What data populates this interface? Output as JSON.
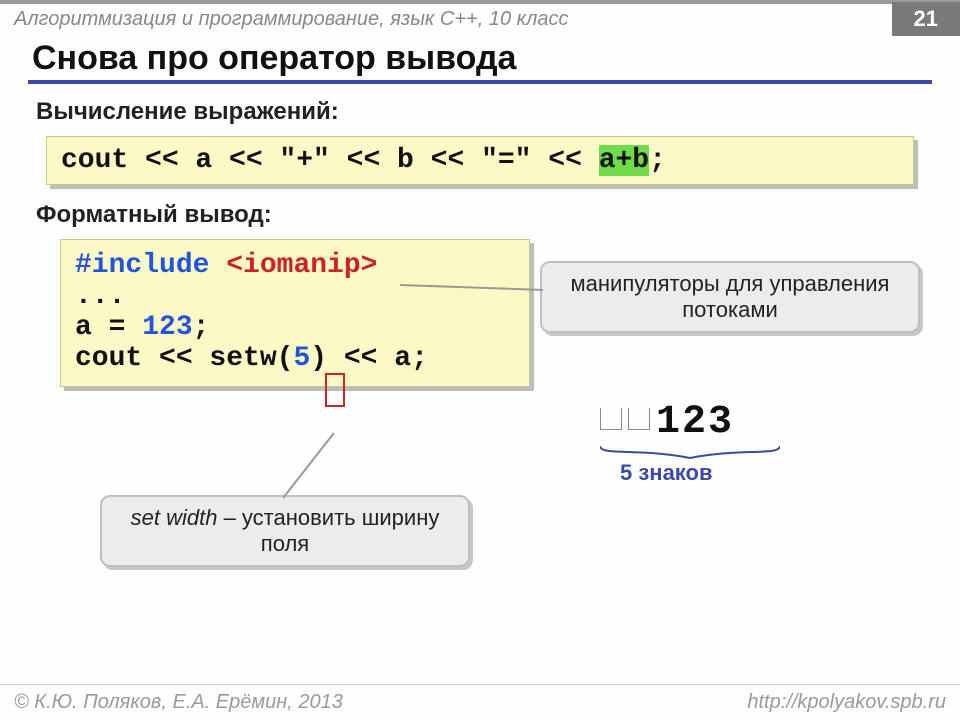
{
  "header": {
    "course": "Алгоритмизация и программирование, язык  C++, 10 класс",
    "page": "21"
  },
  "title": "Снова про оператор вывода",
  "sections": {
    "sub1": "Вычисление выражений:",
    "sub2": "Форматный вывод:"
  },
  "code1": {
    "pre": "cout << a << \"+\" << b << \"=\" << ",
    "hl": "a+b",
    "post": ";"
  },
  "code2": {
    "l1a": "#include ",
    "l1b": "<iomanip>",
    "l2": "...",
    "l3a": "a = ",
    "l3b": "123",
    "l3c": ";",
    "l4a": "cout << setw(",
    "l4b": "5",
    "l4c": ") << a;"
  },
  "callouts": {
    "c1": "манипуляторы для управления потоками",
    "c2a": "set width",
    "c2b": " – установить ширину поля"
  },
  "output": {
    "val": "123",
    "brace": "5 знаков"
  },
  "footer": {
    "left": "© К.Ю. Поляков, Е.А. Ерёмин, 2013",
    "right": "http://kpolyakov.spb.ru"
  }
}
